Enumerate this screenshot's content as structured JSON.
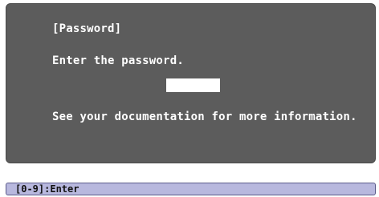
{
  "dialog": {
    "title": "[Password]",
    "prompt": "Enter the password.",
    "password_value": "",
    "info": "See your documentation for more information."
  },
  "status_bar": {
    "hint": "[0-9]:Enter"
  },
  "colors": {
    "dialog_background": "#5c5c5c",
    "dialog_text": "#ffffff",
    "input_background": "#ffffff",
    "status_background": "#b8b8de"
  }
}
